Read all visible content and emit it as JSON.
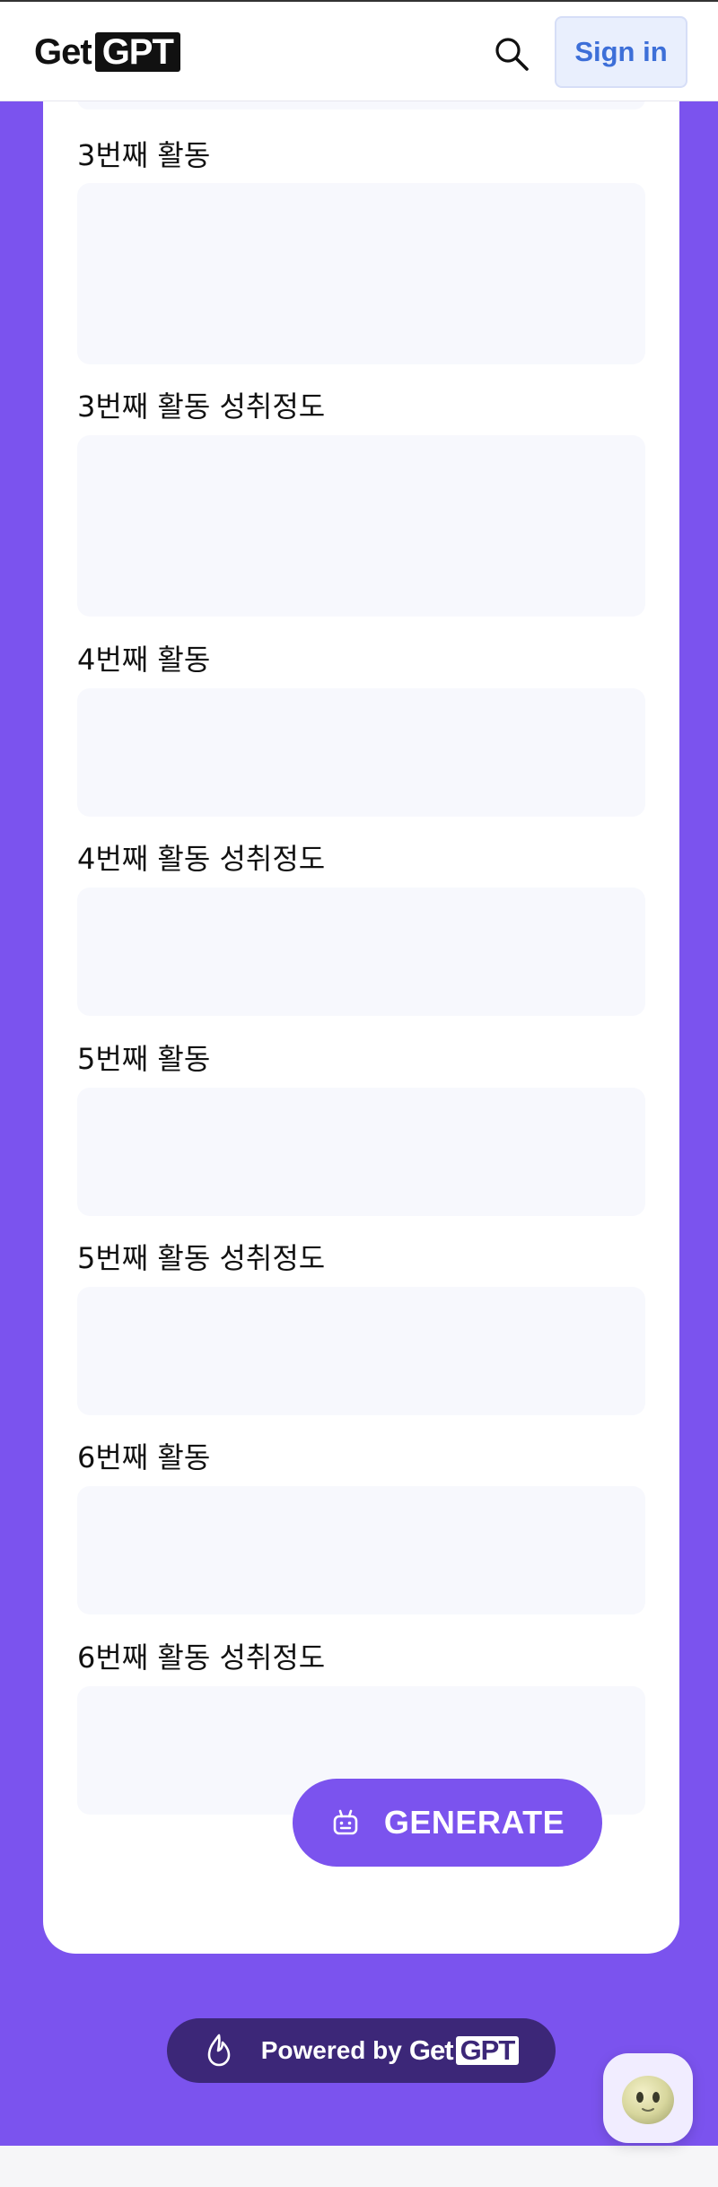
{
  "header": {
    "logo_left": "Get",
    "logo_box": "GPT",
    "sign_in_label": "Sign in"
  },
  "fields": [
    {
      "label": "3번째 활동",
      "value": ""
    },
    {
      "label": "3번째 활동 성취정도",
      "value": ""
    },
    {
      "label": "4번째 활동",
      "value": ""
    },
    {
      "label": "4번째 활동 성취정도",
      "value": ""
    },
    {
      "label": "5번째 활동",
      "value": ""
    },
    {
      "label": "5번째 활동 성취정도",
      "value": ""
    },
    {
      "label": "6번째 활동",
      "value": ""
    },
    {
      "label": "6번째 활동 성취정도",
      "value": ""
    }
  ],
  "generate": {
    "label": "GENERATE",
    "icon": "robot-icon"
  },
  "powered": {
    "text": "Powered by",
    "logo_left": "Get",
    "logo_box": "GPT",
    "icon": "flame-icon"
  },
  "colors": {
    "accent": "#7b53ee",
    "powered_bg": "#3c2778",
    "signin_text": "#3d6fd8"
  }
}
